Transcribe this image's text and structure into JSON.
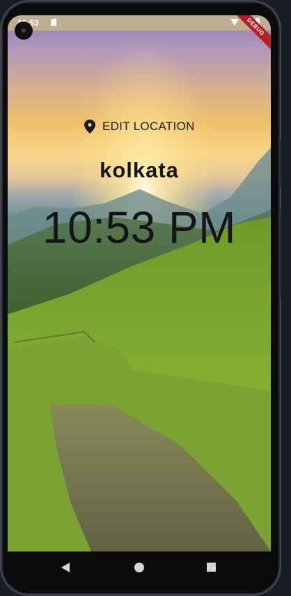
{
  "status_bar": {
    "time": "10:53",
    "icons": [
      "sd-card-icon",
      "wifi-icon",
      "battery-icon"
    ]
  },
  "debug_banner": "DEBUG",
  "location": {
    "edit_label": "EDIT LOCATION",
    "icon": "location-pin-icon"
  },
  "city": "kolkata",
  "time": "10:53 PM",
  "navigation": {
    "back": "back-icon",
    "home": "home-icon",
    "recents": "recents-icon"
  },
  "colors": {
    "status_bar": "#bfae92",
    "text": "#151515",
    "debug": "#b3202a",
    "nav_bar": "#0b0b0d"
  }
}
